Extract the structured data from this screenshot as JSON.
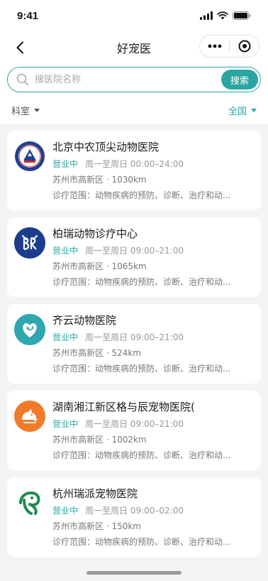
{
  "status_bar": {
    "time": "9:41"
  },
  "navbar": {
    "title": "好宠医"
  },
  "search": {
    "placeholder": "搜医院名称",
    "button": "搜索"
  },
  "filters": {
    "category": "科室",
    "region": "全国"
  },
  "colors": {
    "accent": "#2aa6a2",
    "background": "#f3f4f6"
  },
  "hospitals": [
    {
      "name": "北京中农顶尖动物医院",
      "status": "营业中",
      "hours": "周一至周日 00:00–24:00",
      "location": "苏州市高新区 · 1030km",
      "scope": "诊疗范围：动物疾病的预防、诊断、治疗和动...",
      "logo": "seal-logo-icon"
    },
    {
      "name": "柏瑞动物诊疗中心",
      "status": "营业中",
      "hours": "周一至周日 09:00–21:00",
      "location": "苏州市高新区 · 1065km",
      "scope": "诊疗范围：动物疾病的预防、诊断、治疗和动...",
      "logo": "br-logo-icon"
    },
    {
      "name": "齐云动物医院",
      "status": "营业中",
      "hours": "周一至周日 09:00–21:00",
      "location": "苏州市高新区 · 524km",
      "scope": "诊疗范围：动物疾病的预防、诊断、治疗和动...",
      "logo": "pet-heart-logo-icon"
    },
    {
      "name": "湖南湘江新区格与辰宠物医院(",
      "status": "营业中",
      "hours": "周一至周日 09:00–21:00",
      "location": "苏州市高新区 · 1002km",
      "scope": "诊疗范围：动物疾病的预防、诊断、治疗和动...",
      "logo": "dog-logo-icon"
    },
    {
      "name": "杭州瑞派宠物医院",
      "status": "营业中",
      "hours": "周一至周日 09:00–02:00",
      "location": "苏州市高新区 · 150km",
      "scope": "诊疗范围：动物疾病的预防、诊断、治疗和动...",
      "logo": "ruipai-logo-icon"
    }
  ]
}
